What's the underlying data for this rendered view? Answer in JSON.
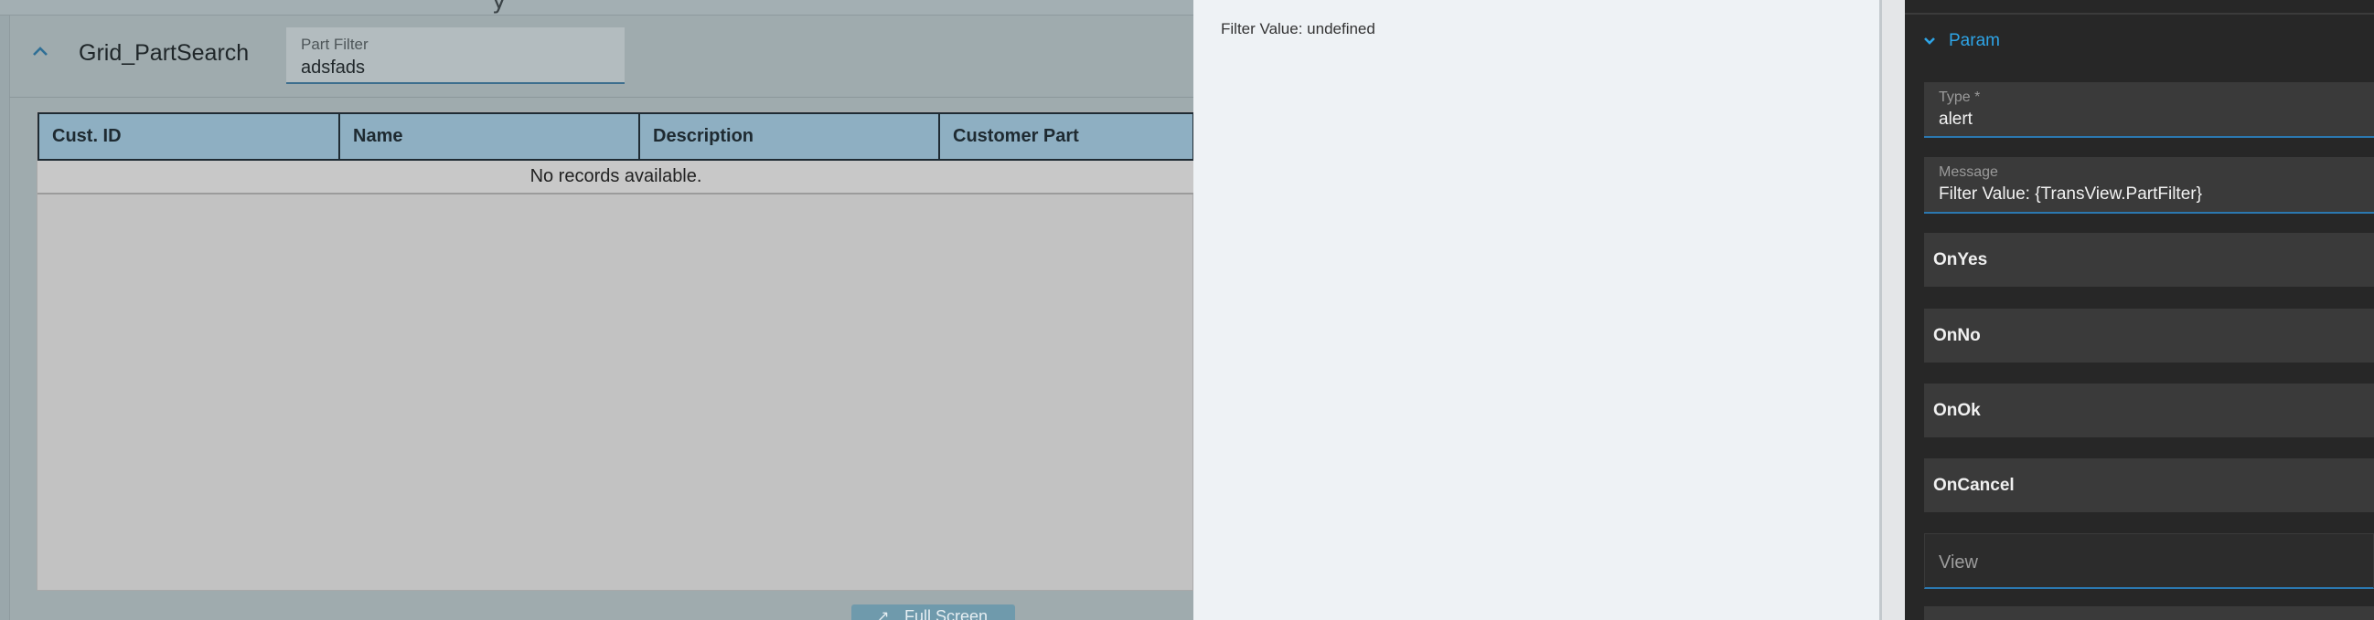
{
  "left_panel": {
    "top_glyph": "y",
    "grid_title": "Grid_PartSearch",
    "part_filter": {
      "label": "Part Filter",
      "value": "adsfads"
    },
    "grid": {
      "columns": [
        "Cust. ID",
        "Name",
        "Description",
        "Customer Part"
      ],
      "empty_message": "No records available."
    },
    "full_screen_label": "Full Screen"
  },
  "alert_pane": {
    "message": "Filter Value: undefined"
  },
  "properties_pane": {
    "section_label": "Param",
    "type_field": {
      "label": "Type *",
      "value": "alert"
    },
    "message_field": {
      "label": "Message",
      "value": "Filter Value: {TransView.PartFilter}"
    },
    "event_rows": [
      "OnYes",
      "OnNo",
      "OnOk",
      "OnCancel"
    ],
    "view_placeholder": "View"
  },
  "colors": {
    "accent_blue": "#2ea4e6",
    "grid_header": "#8eafc2",
    "dark_pane": "#272727"
  }
}
